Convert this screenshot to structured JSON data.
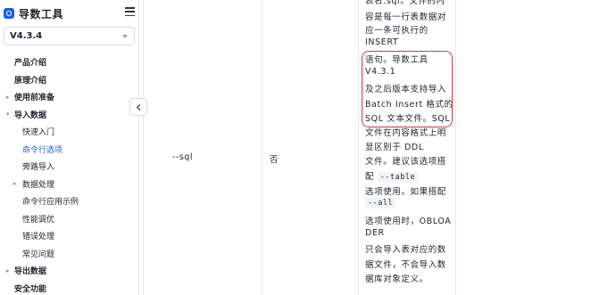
{
  "app": {
    "title": "导数工具"
  },
  "version_select": {
    "value": "V4.3.4"
  },
  "nav": {
    "items": [
      {
        "label": "产品介绍",
        "level": 1,
        "has_arrow": false,
        "active": false
      },
      {
        "label": "原理介绍",
        "level": 1,
        "has_arrow": false,
        "active": false
      },
      {
        "label": "使用前准备",
        "level": 1,
        "has_arrow": true,
        "expanded": false,
        "active": false
      },
      {
        "label": "导入数据",
        "level": 1,
        "has_arrow": true,
        "expanded": true,
        "active": false
      },
      {
        "label": "快速入门",
        "level": 2,
        "has_arrow": false,
        "active": false
      },
      {
        "label": "命令行选项",
        "level": 2,
        "has_arrow": false,
        "active": true
      },
      {
        "label": "旁路导入",
        "level": 2,
        "has_arrow": false,
        "active": false
      },
      {
        "label": "数据处理",
        "level": 2,
        "has_arrow": true,
        "expanded": false,
        "active": false
      },
      {
        "label": "命令行应用示例",
        "level": 2,
        "has_arrow": false,
        "active": false
      },
      {
        "label": "性能调优",
        "level": 2,
        "has_arrow": false,
        "active": false
      },
      {
        "label": "错误处理",
        "level": 2,
        "has_arrow": false,
        "active": false
      },
      {
        "label": "常见问题",
        "level": 2,
        "has_arrow": false,
        "active": false
      },
      {
        "label": "导出数据",
        "level": 1,
        "has_arrow": true,
        "expanded": false,
        "active": false
      },
      {
        "label": "安全功能",
        "level": 1,
        "has_arrow": false,
        "active": false
      }
    ]
  },
  "table": {
    "option": "--sql",
    "required": "否",
    "description_lines": [
      {
        "text": "表名.sql。文件的内"
      },
      {
        "text": "容是每一行表数据对"
      },
      {
        "text": "应一条可执行的"
      },
      {
        "text": "INSERT"
      },
      {
        "text": "语句。导数工具"
      },
      {
        "text": "V4.3.1"
      },
      {
        "text": "及之后版本支持导入"
      },
      {
        "text": "Batch Insert 格式的"
      },
      {
        "text": "SQL 文本文件。SQL"
      },
      {
        "text": "文件在内容格式上明"
      },
      {
        "text": "显区别于 DDL"
      },
      {
        "text": "文件。建议该选项搭"
      },
      {
        "pre": "配 ",
        "code": "--table"
      },
      {
        "text": "选项使用。如果搭配"
      },
      {
        "code": "--all"
      },
      {
        "text": "选项使用时，OBLOA"
      },
      {
        "text": "DER"
      },
      {
        "text": "只会导入表对应的数"
      },
      {
        "text": "据文件，不会导入数"
      },
      {
        "text": "据库对象定义。"
      }
    ]
  },
  "colors": {
    "accent": "#1a5ee6",
    "highlight_border": "#d9363e",
    "divider": "#e4e6ea"
  },
  "icons": {
    "brand": "brand-logo-icon",
    "menu": "menu-icon",
    "collapse": "chevron-left-icon",
    "caret": "caret-down-icon",
    "tree_arrow": "caret-right-icon"
  }
}
